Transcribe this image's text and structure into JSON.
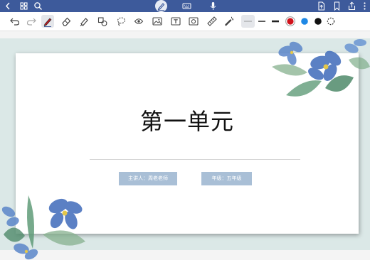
{
  "topbar": {
    "icons": [
      "back-icon",
      "grid-icon",
      "search-icon",
      "pen-mode-icon",
      "keyboard-icon",
      "microphone-icon",
      "export-icon",
      "bookmark-icon",
      "share-icon",
      "more-icon"
    ],
    "accent": "#3d5a9b"
  },
  "toolbar": {
    "tools": [
      "undo-icon",
      "redo-icon",
      "pen-icon",
      "eraser-icon",
      "highlighter-icon",
      "shapes-icon",
      "lasso-icon",
      "sticker-icon",
      "image-icon",
      "text-icon",
      "photo-icon",
      "ruler-icon",
      "laser-pointer-icon"
    ],
    "stroke_options": [
      "thin",
      "medium",
      "thick"
    ],
    "selected_stroke": "thin",
    "colors": [
      "#d0121b",
      "#1e88e5",
      "#111111"
    ],
    "selected_color": "#d0121b"
  },
  "slide": {
    "title": "第一单元",
    "presenter_tag": "主讲人：周老老师",
    "grade_tag": "年级：五年级",
    "tag_color": "#a9bfd6",
    "background_band_color": "#dbe8e7"
  }
}
